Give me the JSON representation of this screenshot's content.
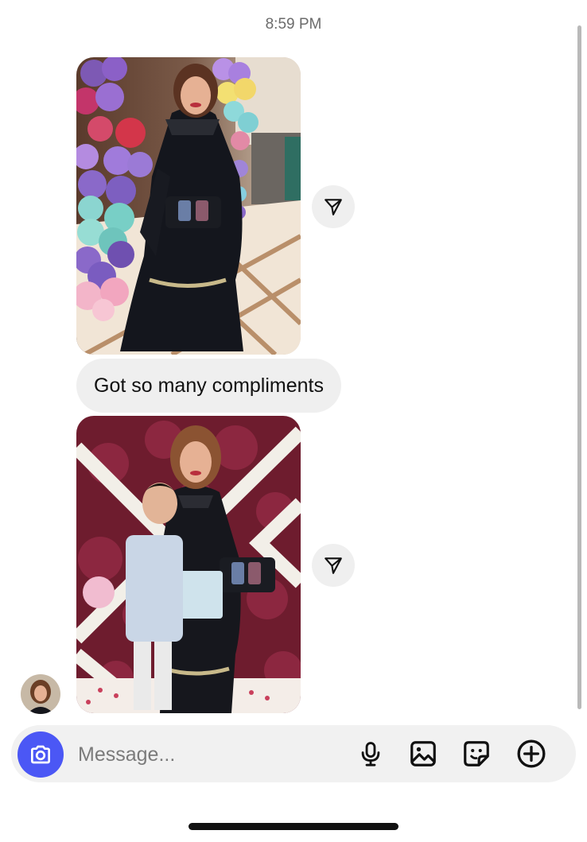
{
  "timestamp": "8:59 PM",
  "messages": [
    {
      "type": "image",
      "subject": "woman-black-dress-balloons"
    },
    {
      "type": "text",
      "text": "Got so many compliments"
    },
    {
      "type": "image",
      "subject": "woman-and-boy-flower-wall"
    }
  ],
  "composer": {
    "placeholder": "Message...",
    "icons": [
      "camera-icon",
      "microphone-icon",
      "gallery-icon",
      "sticker-icon",
      "plus-icon"
    ]
  },
  "icons": {
    "share": "paper-plane-icon"
  },
  "colors": {
    "accent": "#4b57f5",
    "bubble_bg": "#efefef",
    "composer_bg": "#f1f1f1",
    "timestamp": "#6b6b6b"
  }
}
